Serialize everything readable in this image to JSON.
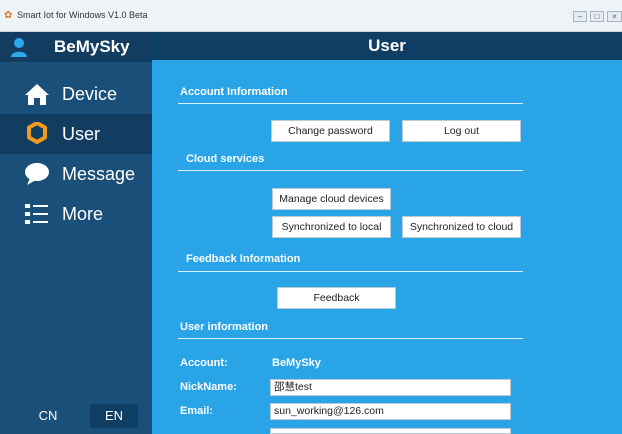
{
  "window": {
    "title": "Smart Iot for Windows V1.0 Beta"
  },
  "sidebar": {
    "brand": "BeMySky",
    "items": [
      {
        "label": "Device",
        "icon": "home-icon"
      },
      {
        "label": "User",
        "icon": "gear-icon"
      },
      {
        "label": "Message",
        "icon": "chat-bubble-icon"
      },
      {
        "label": "More",
        "icon": "list-icon"
      }
    ],
    "active": "User",
    "languages": [
      "CN",
      "EN"
    ],
    "active_language": "EN"
  },
  "page": {
    "title": "User"
  },
  "account_information": {
    "title": "Account Information",
    "change_password": "Change password",
    "log_out": "Log out"
  },
  "cloud_services": {
    "title": "Cloud services",
    "manage_cloud_devices": "Manage cloud devices",
    "synchronized_to_local": "Synchronized to local",
    "synchronized_to_cloud": "Synchronized to cloud"
  },
  "feedback_information": {
    "title": "Feedback Information",
    "feedback": "Feedback"
  },
  "user_information": {
    "title": "User information",
    "account_label": "Account:",
    "account_value": "BeMySky",
    "nickname_label": "NickName:",
    "nickname_value": "邵慧test",
    "email_label": "Email:",
    "email_value": "sun_working@126.com"
  },
  "colors": {
    "sidebar": "#1a4f79",
    "sidebar_dark": "#123d60",
    "main": "#29a4e6",
    "topbar": "#0f3e64",
    "accent_orange": "#f39a1c"
  }
}
